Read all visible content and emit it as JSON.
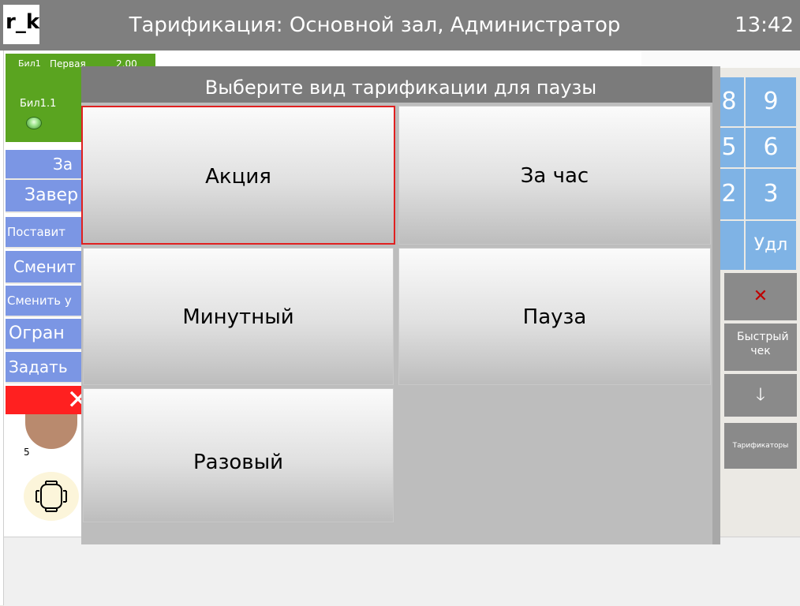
{
  "header": {
    "logo": "r_k",
    "title": "Тарификация: Основной зал, Администратор",
    "time": "13:42"
  },
  "table_card": {
    "hall": "Бил1",
    "tariff": "Первая",
    "amount": "2.00",
    "name": "Бил1.1"
  },
  "left_actions": [
    "За",
    "Завер",
    "Поставит",
    "Сменит",
    "Сменить у",
    "Огран",
    "Задать"
  ],
  "tables": [
    {
      "number": "5"
    }
  ],
  "keypad": {
    "keys": [
      "8",
      "9",
      "5",
      "6",
      "2",
      "3",
      "Удл"
    ],
    "cancel_icon": "close-icon",
    "quick_check": "Быстрый чек",
    "arrow_icon": "arrow-down-icon",
    "tariffs": "Тарификаторы"
  },
  "modal": {
    "title": "Выберите вид тарификации для паузы",
    "options": [
      "Акция",
      "За час",
      "Минутный",
      "Пауза",
      "Разовый"
    ],
    "selected": "Акция"
  },
  "colors": {
    "header_bg": "#7f7f7f",
    "action_blue": "#7b96e4",
    "table_green": "#5aa420",
    "close_red": "#ff2020",
    "keypad_blue": "#7fb3e5",
    "selection_red": "#e02020"
  }
}
